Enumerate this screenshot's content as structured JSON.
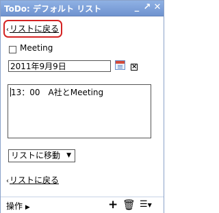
{
  "window": {
    "title": "ToDo: デフォルト リスト",
    "minimize_glyph": "_",
    "popout_glyph": "↗",
    "close_glyph": "✕"
  },
  "nav": {
    "back_link_top": "リストに戻る",
    "back_link_bottom": "リストに戻る"
  },
  "task": {
    "title": "Meeting",
    "completed": false,
    "due_date": "2011年9月9日",
    "notes": "13：00　A社とMeeting",
    "move_label": "リストに移動"
  },
  "footer": {
    "actions_label": "操作",
    "add_icon": "plus-icon",
    "delete_icon": "trash-icon",
    "list_menu_icon": "list-menu-icon"
  },
  "colors": {
    "titlebar": "#7a9dd8",
    "highlight": "#d42222"
  }
}
